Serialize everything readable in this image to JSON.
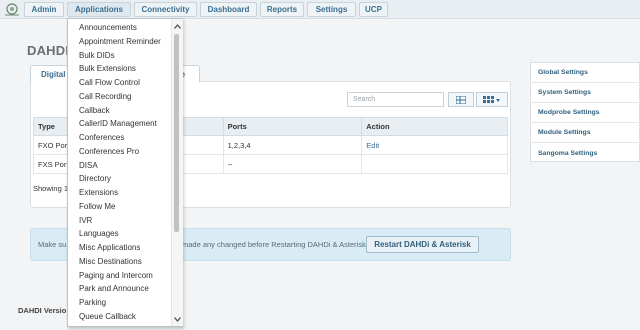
{
  "nav": {
    "items": [
      "Admin",
      "Applications",
      "Connectivity",
      "Dashboard",
      "Reports",
      "Settings",
      "UCP"
    ]
  },
  "page": {
    "title": "DAHDI",
    "tabs": [
      "Digital",
      "are"
    ]
  },
  "table": {
    "search_placeholder": "Search",
    "headers": [
      "Type",
      "",
      "Ports",
      "Action"
    ],
    "rows": [
      [
        "FXO Port",
        "",
        "1,2,3,4",
        "Edit"
      ],
      [
        "FXS Ports",
        "",
        "--",
        ""
      ]
    ],
    "showing": "Showing 1"
  },
  "notice": {
    "text_left": "Make su",
    "text_right": "made any changed before Restarting DAHDi & Asterisk",
    "button": "Restart DAHDi & Asterisk"
  },
  "footer": {
    "text": "DAHDI Versio"
  },
  "sidebar": {
    "items": [
      "Global Settings",
      "System Settings",
      "Modprobe Settings",
      "Module Settings",
      "Sangoma Settings"
    ]
  },
  "dropdown": {
    "items": [
      "Announcements",
      "Appointment Reminder",
      "Bulk DIDs",
      "Bulk Extensions",
      "Call Flow Control",
      "Call Recording",
      "Callback",
      "CallerID Management",
      "Conferences",
      "Conferences Pro",
      "DISA",
      "Directory",
      "Extensions",
      "Follow Me",
      "IVR",
      "Languages",
      "Misc Applications",
      "Misc Destinations",
      "Paging and Intercom",
      "Park and Announce",
      "Parking",
      "Queue Callback"
    ]
  },
  "colors": {
    "accent": "#3a6f92",
    "nav_bg": "#e8eef2",
    "notice_bg": "#d9ebf4"
  }
}
